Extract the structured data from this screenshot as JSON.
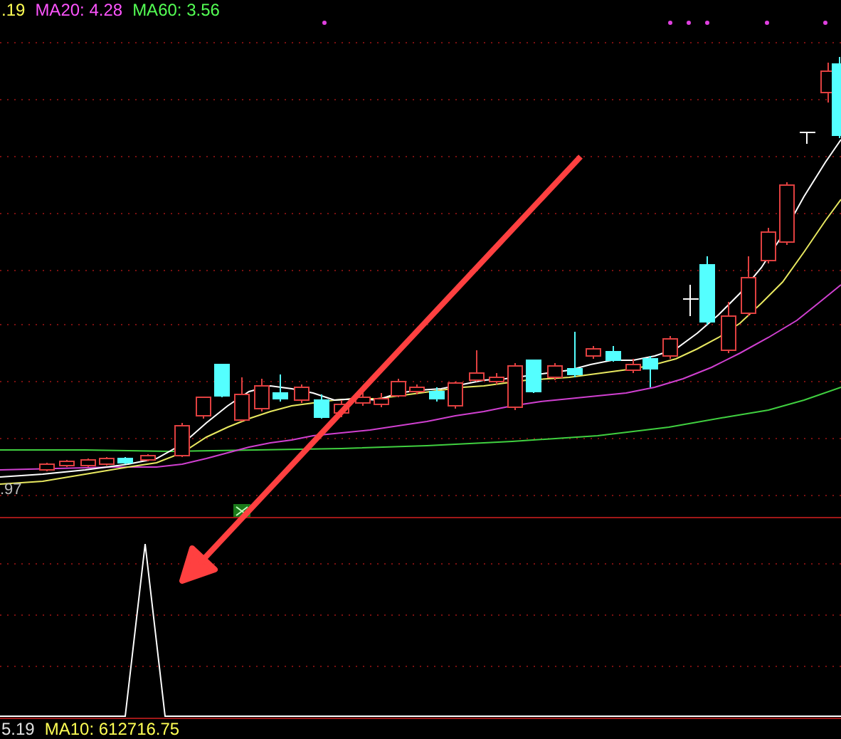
{
  "legend_top": [
    {
      "text": ".19",
      "color": "#ffff54"
    },
    {
      "text": "MA20: 4.28",
      "color": "#ff54ff"
    },
    {
      "text": "MA60: 3.56",
      "color": "#54ff54"
    }
  ],
  "price_label": ".97",
  "legend_bottom": [
    {
      "text": "5.19",
      "color": "#e0e0e0"
    },
    {
      "text": "MA10: 612716.75",
      "color": "#ffff54"
    }
  ]
}
